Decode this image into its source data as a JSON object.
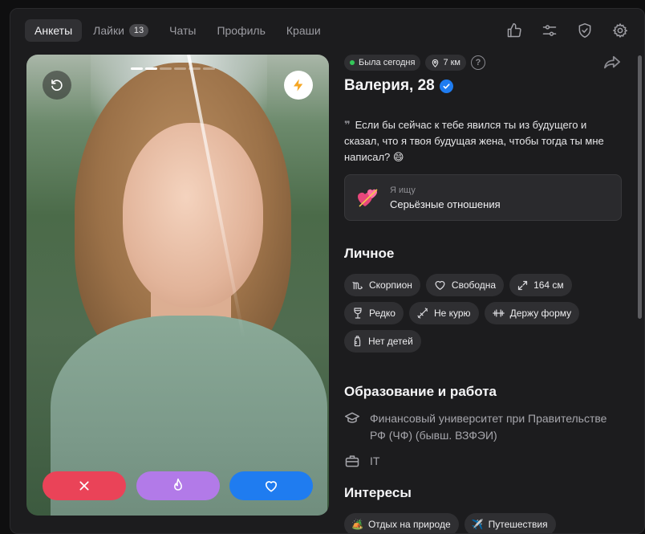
{
  "nav": {
    "tabs": [
      {
        "label": "Анкеты",
        "active": true
      },
      {
        "label": "Лайки",
        "badge": "13"
      },
      {
        "label": "Чаты"
      },
      {
        "label": "Профиль"
      },
      {
        "label": "Краши"
      }
    ],
    "icons": [
      "thumbs-up-icon",
      "sliders-icon",
      "shield-check-icon",
      "gear-icon"
    ]
  },
  "photo": {
    "carousel_pages": 6,
    "carousel_current": 2,
    "actions": [
      "close-icon",
      "fire-icon",
      "heart-icon"
    ]
  },
  "profile": {
    "status": "Была сегодня",
    "distance": "7 км",
    "help": "?",
    "name": "Валерия, 28",
    "quote": "Если бы сейчас к тебе явился ты из будущего и сказал, что я твоя будущая жена, чтобы тогда ты мне написал? 😄",
    "seeking_label": "Я ищу",
    "seeking_value": "Серьёзные отношения"
  },
  "personal": {
    "title": "Личное",
    "tags": [
      {
        "icon": "scorpio-icon",
        "label": "Скорпион"
      },
      {
        "icon": "heart-outline-icon",
        "label": "Свободна"
      },
      {
        "icon": "expand-icon",
        "label": "164 см"
      },
      {
        "icon": "wine-glass-icon",
        "label": "Редко"
      },
      {
        "icon": "no-smoking-icon",
        "label": "Не курю"
      },
      {
        "icon": "dumbbell-icon",
        "label": "Держу форму"
      },
      {
        "icon": "baby-bottle-icon",
        "label": "Нет детей"
      }
    ]
  },
  "education": {
    "title": "Образование и работа",
    "university": "Финансовый университет при Правительстве РФ (ЧФ) (бывш. ВЗФЭИ)",
    "job": "IT"
  },
  "interests": {
    "title": "Интересы",
    "tags": [
      {
        "emoji": "🏕️",
        "label": "Отдых на природе"
      },
      {
        "emoji": "✈️",
        "label": "Путешествия"
      }
    ]
  },
  "colors": {
    "background": "#1c1c1e",
    "dislike": "#ea4358",
    "super": "#b27ae8",
    "like": "#1f7cf0",
    "online": "#34c759",
    "verified": "#1f7cf0"
  }
}
